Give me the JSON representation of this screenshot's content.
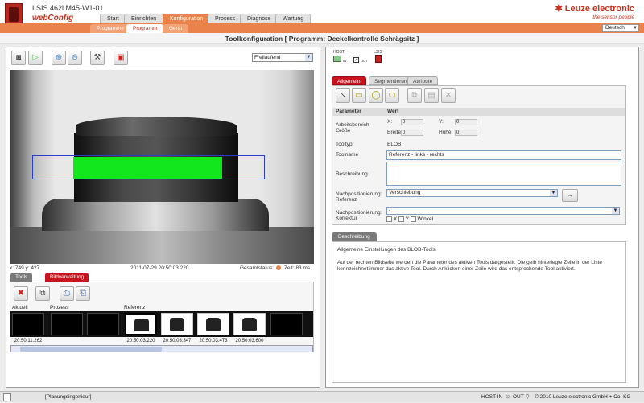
{
  "header": {
    "device_title": "LSIS 462i M45-W1-01",
    "app_name": "webConfig",
    "brand": "Leuze electronic",
    "tagline": "the sensor people",
    "main_tabs": [
      "Start",
      "Einrichten",
      "Konfiguration",
      "Process",
      "Diagnose",
      "Wartung"
    ],
    "sub_tabs": [
      "Programme",
      "Programm",
      "Gerät"
    ],
    "language": "Deutsch"
  },
  "page_title": "Toolkonfiguration    [ Programm: Deckelkontrolle Schrägsitz ]",
  "left": {
    "mode_select": "Freilaufend",
    "coords": "x: 749 y: 427",
    "timestamp": "2011-07-29 20:50:03.220",
    "gesamtstatus_label": "Gesamtstatus:",
    "zeit": "Zeit: 83 ms",
    "lower_tabs": [
      "Tools",
      "Bildverwaltung"
    ],
    "film_labels": [
      "Aktuell",
      "Prozess",
      "Referenz"
    ],
    "timestamps": [
      "20:50:11.262",
      "20:50:03.220",
      "20:50:03.347",
      "20:50:03.473",
      "20:50:03.600"
    ]
  },
  "right": {
    "diagram": {
      "host": "HOST",
      "lsis": "LSIS",
      "in": "IN",
      "out": "OUT"
    },
    "tabs": [
      "Allgemein",
      "Segmentierung",
      "Attribute"
    ],
    "columns": [
      "Parameter",
      "Wert"
    ],
    "rows": {
      "arbeitsbereich": "Arbeitsbereich Größe",
      "x_label": "X:",
      "y_label": "Y:",
      "breite_label": "Breite:",
      "hoehe_label": "Höhe:",
      "x": "0",
      "y": "0",
      "breite": "0",
      "hoehe": "0",
      "tooltyp_label": "Tooltyp",
      "tooltyp_value": "BLOB",
      "toolname_label": "Toolname",
      "toolname_value": "Referenz - links - rechts",
      "beschreibung_label": "Beschreibung",
      "nachpos_ref_label": "Nachpositionierung: Referenz",
      "nachpos_ref_value": "Verschiebung",
      "nachpos_korr_label": "Nachpositionierung: Korrektur",
      "nachpos_korr_value": "-",
      "check_x": "X",
      "check_y": "Y",
      "check_winkel": "Winkel"
    },
    "desc_tab": "Beschreibung",
    "desc_title": "Allgemeine Einstellungen des BLOB-Tools",
    "desc_text": "Auf der rechten Bildseite werden die Parameter des aktiven Tools dargestellt. Die gelb hinterlegte Zeile in der Liste kennzeichnet immer das aktive Tool. Durch Anklicken einer Zeile wird das entsprechende Tool aktiviert."
  },
  "footer": {
    "user": "[Planungsingenieur]",
    "host_in": "HOST IN",
    "out": "OUT",
    "copyright": "© 2010 Leuze electronic GmbH + Co. KG"
  },
  "colors": {
    "accent": "#e9824b",
    "brand_red": "#c8321e",
    "tab_red": "#c8141e",
    "roi_green": "#12e61c",
    "roi_blue": "#2a3cc8"
  }
}
